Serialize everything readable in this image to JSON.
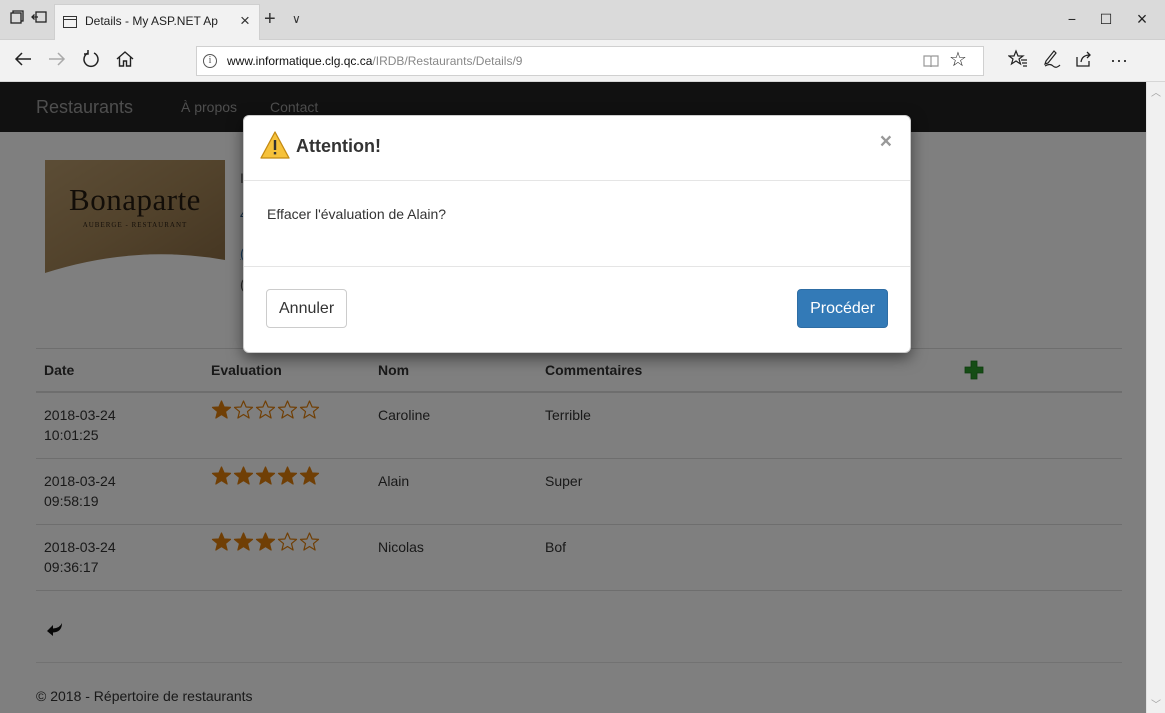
{
  "browser": {
    "tab_title": "Details - My ASP.NET Ap",
    "tab_close": "×",
    "new_tab": "+",
    "tab_list": "∨",
    "minimize": "−",
    "maximize": "☐",
    "close": "×",
    "url_host": "www.informatique.clg.qc.ca",
    "url_path": "/IRDB/Restaurants/Details/9",
    "more": "···"
  },
  "navbar": {
    "brand": "Restaurants",
    "links": [
      "À propos",
      "Contact"
    ]
  },
  "restaurant": {
    "logo_name": "Bonaparte",
    "logo_subtitle": "AUBERGE - RESTAURANT"
  },
  "table": {
    "headers": [
      "Date",
      "Evaluation",
      "Nom",
      "Commentaires"
    ],
    "rows": [
      {
        "date_line1": "2018-03-24",
        "date_line2": "10:01:25",
        "rating": 1,
        "nom": "Caroline",
        "commentaire": "Terrible"
      },
      {
        "date_line1": "2018-03-24",
        "date_line2": "09:58:19",
        "rating": 5,
        "nom": "Alain",
        "commentaire": "Super"
      },
      {
        "date_line1": "2018-03-24",
        "date_line2": "09:36:17",
        "rating": 3,
        "nom": "Nicolas",
        "commentaire": "Bof"
      }
    ],
    "max_rating": 5
  },
  "footer": {
    "text": "© 2018 - Répertoire de restaurants"
  },
  "modal": {
    "title": "Attention!",
    "close": "×",
    "message": "Effacer l'évaluation de Alain?",
    "cancel_label": "Annuler",
    "proceed_label": "Procéder"
  },
  "colors": {
    "navbar": "#222222",
    "primary": "#337ab7",
    "star": "#e07e0b",
    "add_icon": "#2a9a2a",
    "warning": "#f4c133"
  }
}
